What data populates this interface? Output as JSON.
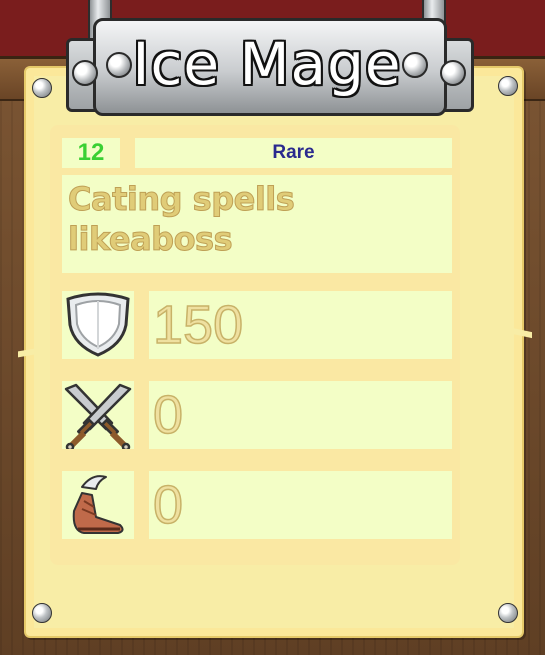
{
  "card": {
    "title": "Ice Mage",
    "level": "12",
    "rarity": "Rare",
    "description": "Cating spells likeaboss"
  },
  "stats": [
    {
      "icon": "shield-icon",
      "value": "150"
    },
    {
      "icon": "crossed-swords-icon",
      "value": "0"
    },
    {
      "icon": "winged-sandal-icon",
      "value": "0"
    }
  ],
  "colors": {
    "level": "#3ad033",
    "rarity": "#2a2a8e",
    "parchment": "#f8eda6",
    "cell": "#f3fec6"
  }
}
